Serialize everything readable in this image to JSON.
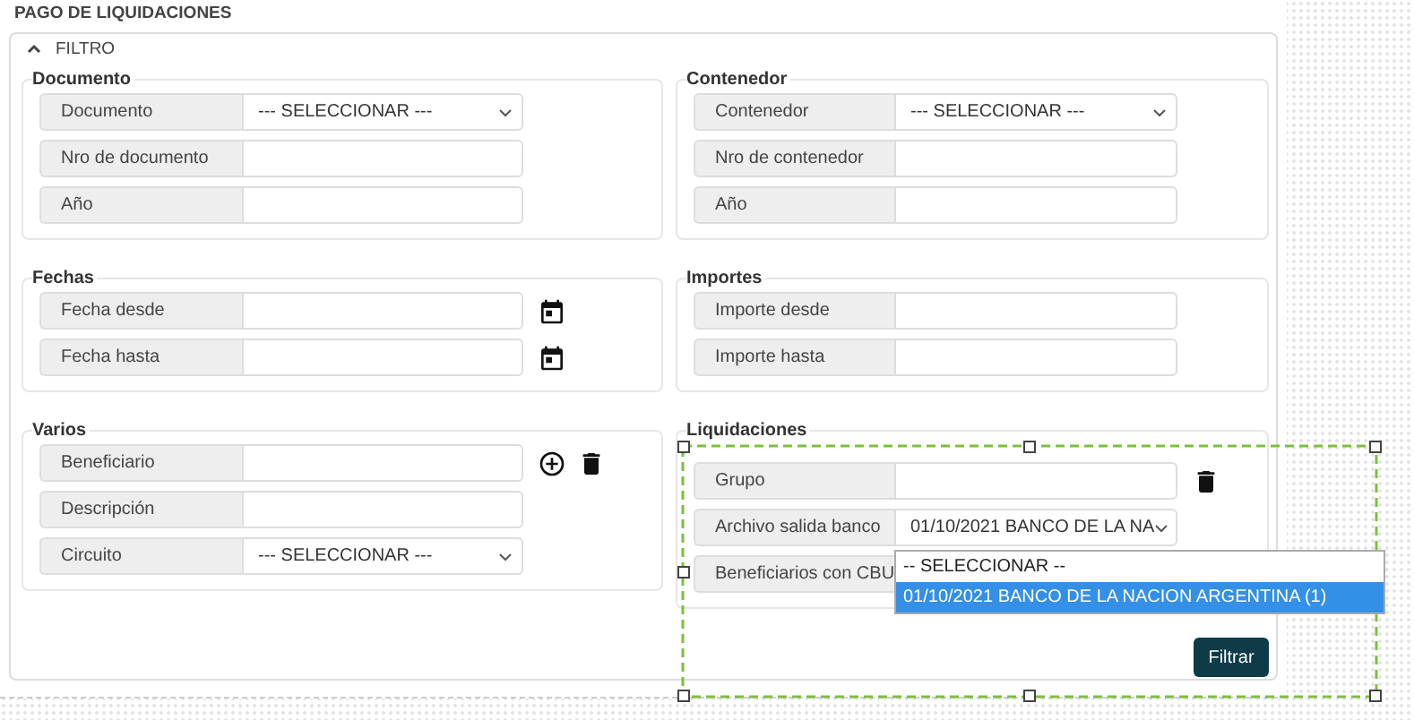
{
  "title": "PAGO DE LIQUIDACIONES",
  "filter": {
    "label": "FILTRO",
    "expanded": true
  },
  "columns": [
    {
      "sections": [
        {
          "title": "Documento",
          "rows": [
            {
              "kind": "select",
              "label": "Documento",
              "value": "--- SELECCIONAR ---"
            },
            {
              "kind": "input",
              "label": "Nro de documento"
            },
            {
              "kind": "input",
              "label": "Año"
            }
          ]
        },
        {
          "title": "Fechas",
          "rows": [
            {
              "kind": "date",
              "label": "Fecha desde"
            },
            {
              "kind": "date",
              "label": "Fecha hasta"
            }
          ]
        },
        {
          "title": "Varios",
          "rows": [
            {
              "kind": "input_add_remove",
              "label": "Beneficiario"
            },
            {
              "kind": "input",
              "label": "Descripción"
            },
            {
              "kind": "select",
              "label": "Circuito",
              "value": "--- SELECCIONAR ---"
            }
          ]
        }
      ]
    },
    {
      "sections": [
        {
          "title": "Contenedor",
          "rows": [
            {
              "kind": "select",
              "label": "Contenedor",
              "value": "--- SELECCIONAR ---"
            },
            {
              "kind": "input",
              "label": "Nro de contenedor"
            },
            {
              "kind": "input",
              "label": "Año"
            }
          ]
        },
        {
          "title": "Importes",
          "rows": [
            {
              "kind": "input",
              "label": "Importe desde"
            },
            {
              "kind": "input",
              "label": "Importe hasta"
            }
          ]
        },
        {
          "title": "Liquidaciones",
          "rows": [
            {
              "kind": "input_remove",
              "label": "Grupo"
            },
            {
              "kind": "select",
              "label": "Archivo salida banco",
              "value": "01/10/2021 BANCO DE LA NA",
              "open": true,
              "options": [
                {
                  "label": "-- SELECCIONAR --",
                  "selected": false
                },
                {
                  "label": "01/10/2021 BANCO DE LA NACION ARGENTINA (1)",
                  "selected": true
                }
              ]
            },
            {
              "kind": "label",
              "label": "Beneficiarios con CBU"
            }
          ]
        }
      ]
    }
  ],
  "filter_button": "Filtrar"
}
